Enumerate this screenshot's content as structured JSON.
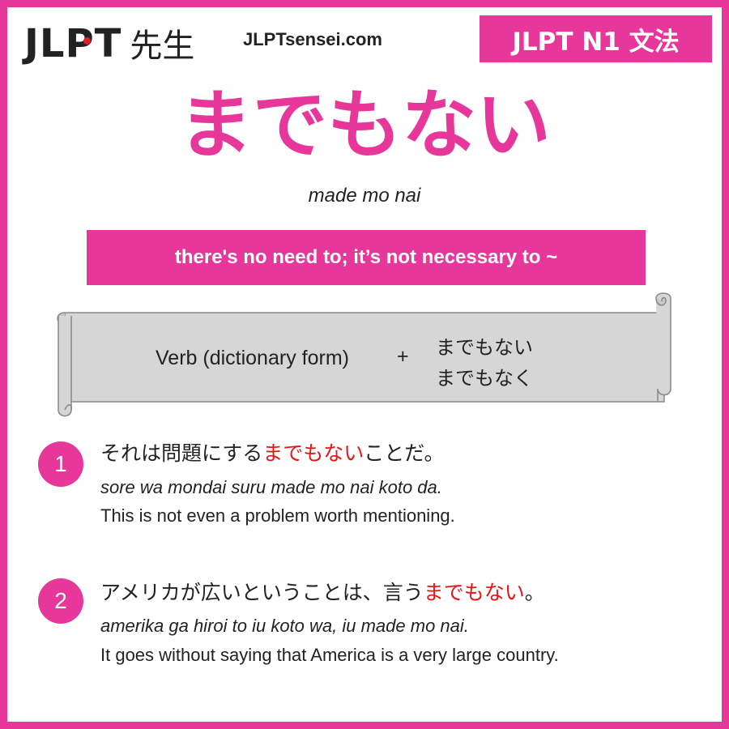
{
  "header": {
    "logo_latin": "JLPT",
    "logo_kanji": "先生",
    "site": "JLPTsensei.com",
    "badge": "JLPT N1 文法"
  },
  "title": "までもない",
  "romaji": "made mo nai",
  "meaning": "there's no need to; it’s not necessary to ~",
  "formula": {
    "left": "Verb (dictionary form)",
    "plus": "+",
    "forms": [
      "までもない",
      "までもなく"
    ]
  },
  "examples": [
    {
      "number": "1",
      "jp_before": "それは問題にする",
      "jp_highlight": "までもない",
      "jp_after": "ことだ。",
      "romaji": "sore wa mondai suru made mo nai koto da.",
      "english": "This is not even a problem worth mentioning."
    },
    {
      "number": "2",
      "jp_before": "アメリカが広いということは、言う",
      "jp_highlight": "までもない",
      "jp_after": "。",
      "romaji": "amerika ga hiroi to iu koto wa, iu made mo nai.",
      "english": "It goes without saying that America is a very large country."
    }
  ],
  "colors": {
    "accent": "#e8379b",
    "highlight": "#e11111",
    "scroll": "#d6d6d6"
  }
}
